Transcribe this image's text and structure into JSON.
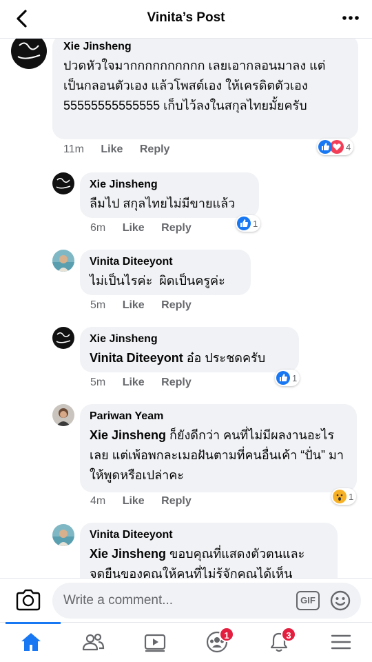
{
  "header": {
    "title": "Vinita’s Post"
  },
  "comments": [
    {
      "author": "Xie Jinsheng",
      "text": "ปวดหัวใจมากกกกกกกกกก เลยเอากลอนมาลง แต่เป็นกลอนตัวเอง แล้วโพสต์เอง ให้เครดิตตัวเอง 55555555555555 เก็บไว้ลงในสกุลไทยมั้ยครับ",
      "time": "11m",
      "like": "Like",
      "reply": "Reply",
      "reaction_count": "4"
    },
    {
      "author": "Xie Jinsheng",
      "text": "ลืมไป สกุลไทยไม่มีขายแล้ว",
      "time": "6m",
      "like": "Like",
      "reply": "Reply",
      "reaction_count": "1"
    },
    {
      "author": "Vinita Diteeyont",
      "text": "ไม่เป็นไรค่ะ  ผิดเป็นครูค่ะ",
      "time": "5m",
      "like": "Like",
      "reply": "Reply"
    },
    {
      "author": "Xie Jinsheng",
      "mention": "Vinita Diteeyont",
      "text": " อ๋อ ประชดครับ",
      "time": "5m",
      "like": "Like",
      "reply": "Reply",
      "reaction_count": "1"
    },
    {
      "author": "Pariwan Yeam",
      "mention": "Xie Jinsheng",
      "text": " ก็ยังดีกว่า คนที่ไม่มีผลงานอะไรเลย แต่เพ้อพกละเมอฝันตามที่คนอื่นเค้า “ปั่น” มาให้พูดหรือเปล่าคะ",
      "time": "4m",
      "like": "Like",
      "reply": "Reply",
      "reaction_count": "1"
    },
    {
      "author": "Vinita Diteeyont",
      "mention": "Xie Jinsheng",
      "text": " ขอบคุณที่แสดงตัวตนและจุดยืนของคุณให้คนที่ไม่รู้จักคุณได้เห็น"
    }
  ],
  "composer": {
    "placeholder": "Write a comment...",
    "gif_label": "GIF"
  },
  "nav": {
    "groups_badge": "1",
    "notifications_badge": "3"
  },
  "colors": {
    "accent": "#1877f2",
    "bubble": "#f0f2f5",
    "meta_text": "#65676b",
    "badge": "#e41e3f"
  }
}
